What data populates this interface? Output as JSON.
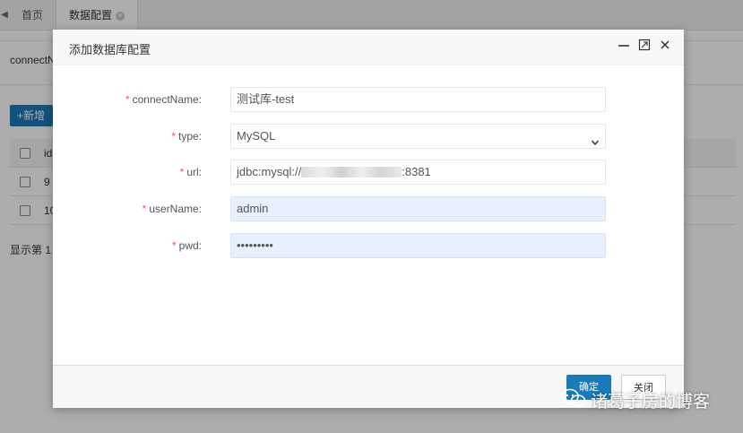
{
  "tabs": {
    "home": "首页",
    "active": "数据配置"
  },
  "background": {
    "search_label": "connectN",
    "add_button": "+新增",
    "grid_header": "id",
    "rows": [
      "9",
      "10"
    ],
    "pager": "显示第 1"
  },
  "dialog": {
    "title": "添加数据库配置",
    "fields": {
      "connect_name": {
        "label": "connectName:",
        "value": "测试库-test"
      },
      "type": {
        "label": "type:",
        "value": "MySQL"
      },
      "url": {
        "label": "url:",
        "prefix": "jdbc:mysql://",
        "suffix": ":8381"
      },
      "user_name": {
        "label": "userName:",
        "value": "admin"
      },
      "pwd": {
        "label": "pwd:",
        "value": "•••••••••"
      }
    },
    "ok_button": "确定",
    "cancel_button": "关闭"
  },
  "watermark": "诸葛子房的博客",
  "colors": {
    "primary": "#1a7bb9",
    "required": "#ed5565",
    "autofill": "#e8f0fe"
  }
}
